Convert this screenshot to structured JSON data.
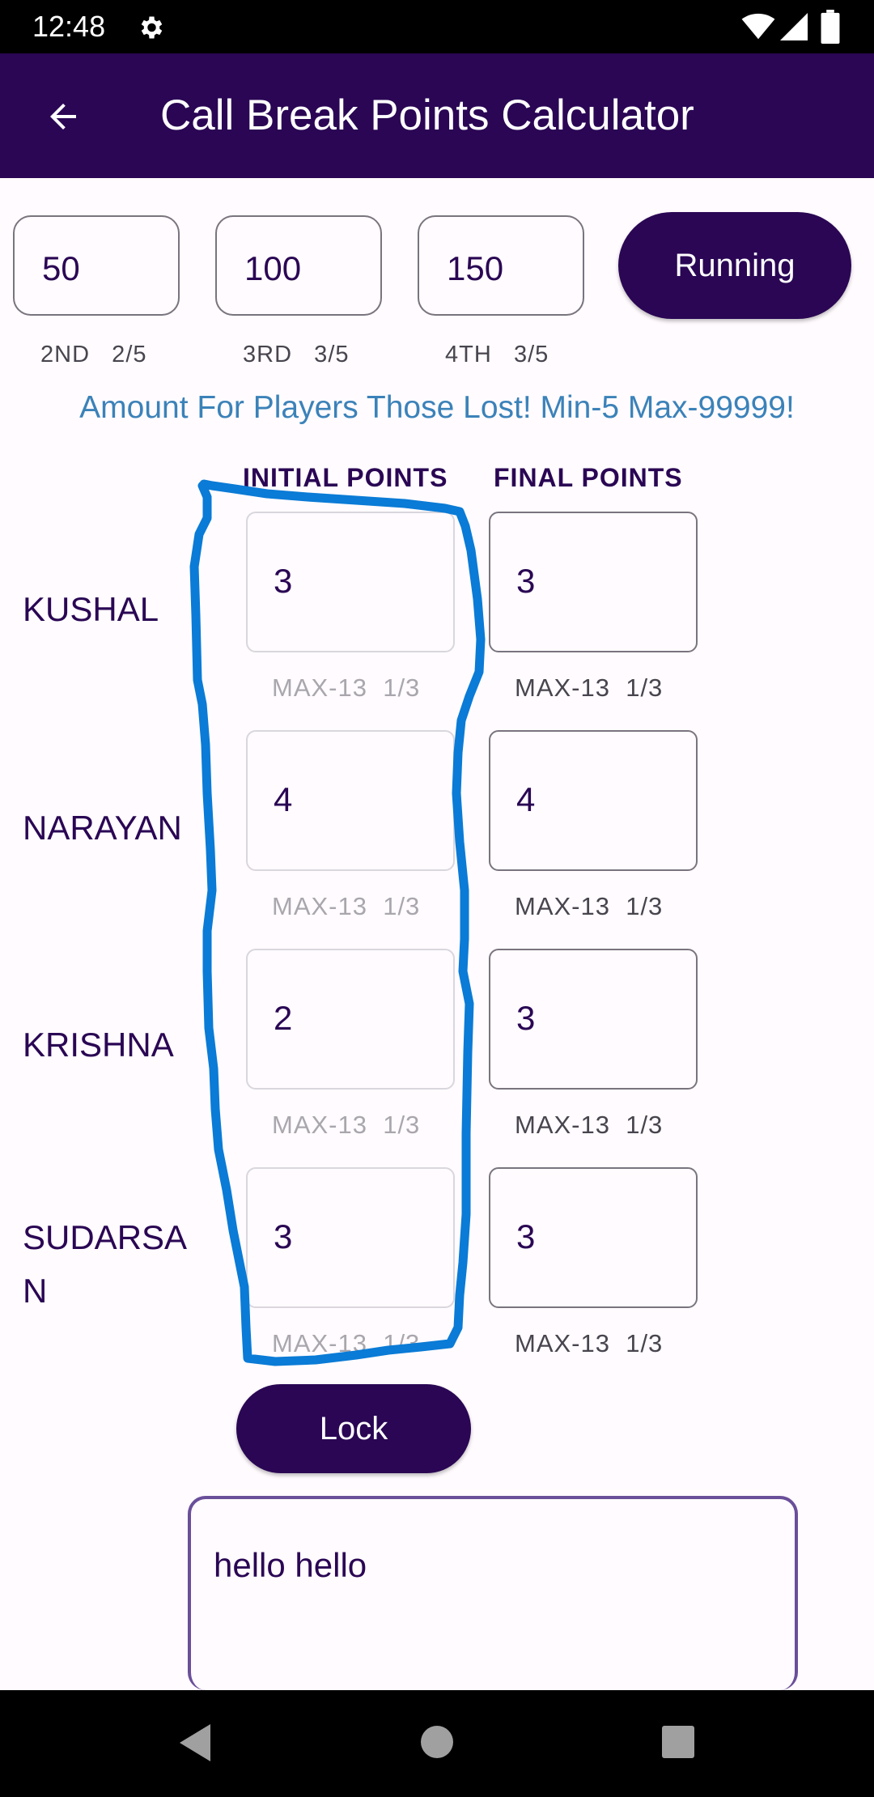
{
  "status_bar": {
    "time": "12:48"
  },
  "app_bar": {
    "title": "Call Break Points Calculator"
  },
  "amounts": [
    {
      "value": "50",
      "helper": "2ND   2/5"
    },
    {
      "value": "100",
      "helper": "3RD   3/5"
    },
    {
      "value": "150",
      "helper": "4TH   3/5"
    }
  ],
  "running_label": "Running",
  "lost_note": "Amount For Players Those Lost! Min-5 Max-99999!",
  "headers": {
    "initial": "INITIAL POINTS",
    "final": "FINAL POINTS"
  },
  "players": [
    {
      "name": "KUSHAL",
      "initial": "3",
      "initial_helper": "MAX-13  1/3",
      "final": "3",
      "final_helper": "MAX-13  1/3"
    },
    {
      "name": "NARAYAN",
      "initial": "4",
      "initial_helper": "MAX-13  1/3",
      "final": "4",
      "final_helper": "MAX-13  1/3"
    },
    {
      "name": "KRISHNA",
      "initial": "2",
      "initial_helper": "MAX-13  1/3",
      "final": "3",
      "final_helper": "MAX-13  1/3"
    },
    {
      "name": "SUDARSAN",
      "initial": "3",
      "initial_helper": "MAX-13  1/3",
      "final": "3",
      "final_helper": "MAX-13  1/3"
    }
  ],
  "lock_label": "Lock",
  "notes_text": "hello hello",
  "colors": {
    "primary": "#2a0654",
    "note_blue": "#3b82b9",
    "annotation": "#0a7bd6"
  }
}
